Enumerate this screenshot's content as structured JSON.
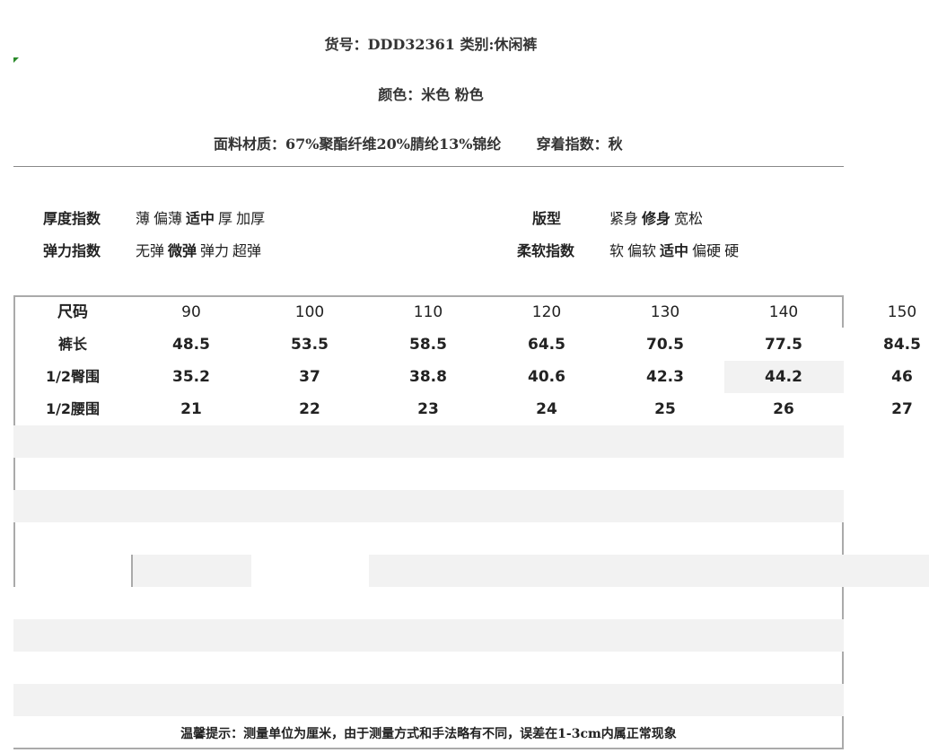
{
  "header": {
    "line1": "货号：DDD32361 类别:休闲裤",
    "line2": "颜色：米色 粉色",
    "line3_material": "面料材质：67%聚酯纤维20%腈纶13%锦纶",
    "line3_wear": "穿着指数：秋"
  },
  "indices": [
    {
      "label": "厚度指数",
      "options": [
        "薄",
        "偏薄",
        "适中",
        "厚",
        "加厚"
      ],
      "selected": "适中"
    },
    {
      "label": "弹力指数",
      "options": [
        "无弹",
        "微弹",
        "弹力",
        "超弹"
      ],
      "selected": "微弹"
    },
    {
      "label": "版型",
      "options": [
        "紧身",
        "修身",
        "宽松"
      ],
      "selected": "修身"
    },
    {
      "label": "柔软指数",
      "options": [
        "软",
        "偏软",
        "适中",
        "偏硬",
        "硬"
      ],
      "selected": "适中"
    }
  ],
  "size_table": {
    "headers": [
      "尺码",
      "90",
      "100",
      "110",
      "120",
      "130",
      "140",
      "150"
    ],
    "rows": [
      {
        "label": "裤长",
        "values": [
          "48.5",
          "53.5",
          "58.5",
          "64.5",
          "70.5",
          "77.5",
          "84.5"
        ]
      },
      {
        "label": "1/2臀围",
        "values": [
          "35.2",
          "37",
          "38.8",
          "40.6",
          "42.3",
          "44.2",
          "46"
        ]
      },
      {
        "label": "1/2腰围",
        "values": [
          "21",
          "22",
          "23",
          "24",
          "25",
          "26",
          "27"
        ]
      }
    ]
  },
  "footer_note": "温馨提示：测量单位为厘米，由于测量方式和手法略有不同，误差在1-3cm内属正常现象"
}
